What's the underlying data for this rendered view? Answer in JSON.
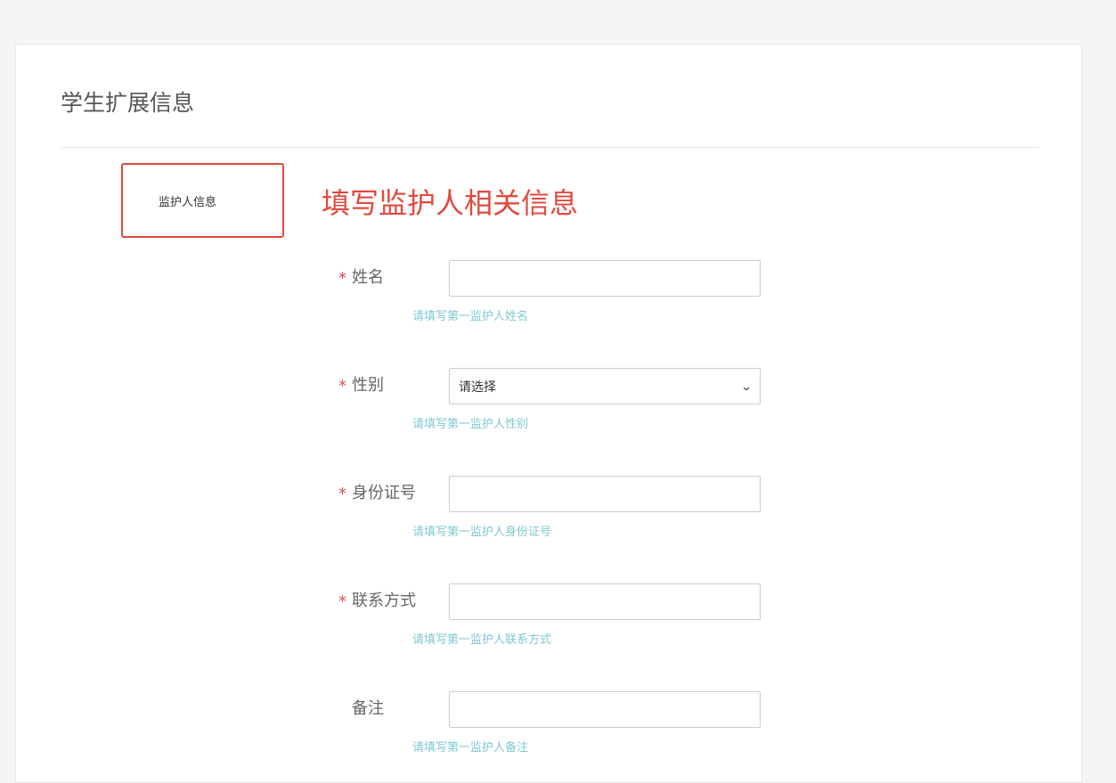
{
  "page": {
    "title": "学生扩展信息"
  },
  "section": {
    "tab_label": "监护人信息",
    "annotation": "填写监护人相关信息"
  },
  "form": {
    "fields": [
      {
        "label": "姓名",
        "required": "*",
        "help": "请填写第一监护人姓名",
        "value": ""
      },
      {
        "label": "性别",
        "required": "*",
        "help": "请填写第一监护人性别",
        "selected": "请选择"
      },
      {
        "label": "身份证号",
        "required": "*",
        "help": "请填写第一监护人身份证号",
        "value": ""
      },
      {
        "label": "联系方式",
        "required": "*",
        "help": "请填写第一监护人联系方式",
        "value": ""
      },
      {
        "label": "备注",
        "required": "",
        "help": "请填写第一监护人备注",
        "value": ""
      }
    ]
  },
  "icons": {
    "select_arrow": "chevron-down-icon"
  },
  "colors": {
    "accent_red": "#e04a3f",
    "required_star": "#d9534f",
    "help_text": "#7ec8d3",
    "title_text": "#555555"
  }
}
